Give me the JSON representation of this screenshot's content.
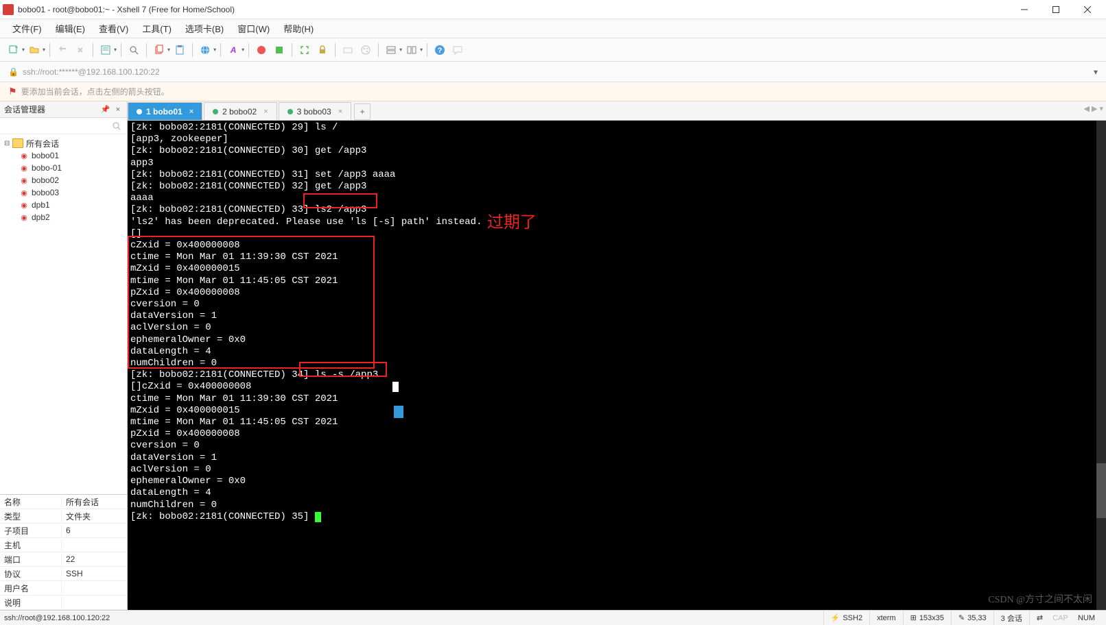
{
  "window": {
    "title": "bobo01 - root@bobo01:~ - Xshell 7 (Free for Home/School)"
  },
  "menu": {
    "file": "文件(F)",
    "edit": "编辑(E)",
    "view": "查看(V)",
    "tools": "工具(T)",
    "tabs": "选项卡(B)",
    "window": "窗口(W)",
    "help": "帮助(H)"
  },
  "address": {
    "url": "ssh://root:******@192.168.100.120:22"
  },
  "hint": {
    "text": "要添加当前会话，点击左侧的箭头按钮。"
  },
  "sidebar": {
    "title": "会话管理器",
    "root": "所有会话",
    "sessions": [
      "bobo01",
      "bobo-01",
      "bobo02",
      "bobo03",
      "dpb1",
      "dpb2"
    ]
  },
  "props": {
    "rows": [
      {
        "k": "名称",
        "v": "所有会话"
      },
      {
        "k": "类型",
        "v": "文件夹"
      },
      {
        "k": "子项目",
        "v": "6"
      },
      {
        "k": "主机",
        "v": ""
      },
      {
        "k": "端口",
        "v": "22"
      },
      {
        "k": "协议",
        "v": "SSH"
      },
      {
        "k": "用户名",
        "v": ""
      },
      {
        "k": "说明",
        "v": ""
      }
    ]
  },
  "tabs": {
    "items": [
      {
        "label": "1 bobo01",
        "active": true
      },
      {
        "label": "2 bobo02",
        "active": false
      },
      {
        "label": "3 bobo03",
        "active": false
      }
    ]
  },
  "terminal": {
    "lines": [
      "[zk: bobo02:2181(CONNECTED) 29] ls /",
      "[app3, zookeeper]",
      "[zk: bobo02:2181(CONNECTED) 30] get /app3",
      "app3",
      "[zk: bobo02:2181(CONNECTED) 31] set /app3 aaaa",
      "[zk: bobo02:2181(CONNECTED) 32] get /app3",
      "aaaa",
      "[zk: bobo02:2181(CONNECTED) 33] ls2 /app3",
      "'ls2' has been deprecated. Please use 'ls [-s] path' instead.",
      "[]",
      "cZxid = 0x400000008",
      "ctime = Mon Mar 01 11:39:30 CST 2021",
      "mZxid = 0x400000015",
      "mtime = Mon Mar 01 11:45:05 CST 2021",
      "pZxid = 0x400000008",
      "cversion = 0",
      "dataVersion = 1",
      "aclVersion = 0",
      "ephemeralOwner = 0x0",
      "dataLength = 4",
      "numChildren = 0",
      "[zk: bobo02:2181(CONNECTED) 34] ls -s /app3",
      "[]cZxid = 0x400000008",
      "ctime = Mon Mar 01 11:39:30 CST 2021",
      "mZxid = 0x400000015",
      "mtime = Mon Mar 01 11:45:05 CST 2021",
      "pZxid = 0x400000008",
      "cversion = 0",
      "dataVersion = 1",
      "aclVersion = 0",
      "ephemeralOwner = 0x0",
      "dataLength = 4",
      "numChildren = 0",
      "",
      "[zk: bobo02:2181(CONNECTED) 35] "
    ],
    "annotation": "过期了"
  },
  "status": {
    "left": "ssh://root@192.168.100.120:22",
    "ssh": "SSH2",
    "term": "xterm",
    "size": "153x35",
    "pos": "35,33",
    "sess": "3 会话",
    "caps": "CAP",
    "num": "NUM"
  },
  "watermark": "CSDN @方寸之间不太闲"
}
